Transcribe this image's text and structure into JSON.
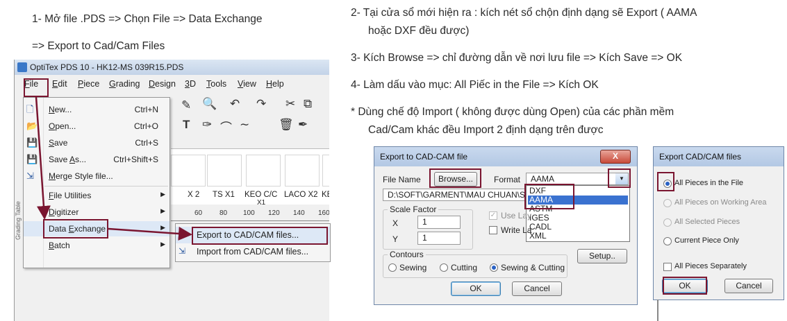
{
  "instructions": {
    "step1_line1": "1-  Mở file .PDS => Chọn File => Data Exchange",
    "step1_line2": "=> Export to Cad/Cam Files",
    "step2_line1": "2-  Tại cửa sổ mới hiện ra : kích nét sổ chộn định dạng sẽ Export ( AAMA",
    "step2_line2": "hoặc DXF đều được)",
    "step3": "3-  Kích Browse => chỉ đường dẫn về nơi lưu file => Kích Save => OK",
    "step4": "4- Làm dấu vào mục: All Piếc in the File => Kích OK",
    "note_line1": "* Dùng chế độ Import ( không được dùng Open) của các phần mềm",
    "note_line2": "Cad/Cam khác đều Import 2 định dạng trên được"
  },
  "pds_window": {
    "title": "OptiTex PDS 10 - HK12-MS 039R15.PDS",
    "side_tab": "Grading Table",
    "menu": [
      {
        "label": "File",
        "underline": "F",
        "rest": "ile"
      },
      {
        "label": "Edit",
        "underline": "E",
        "rest": "dit"
      },
      {
        "label": "Piece",
        "underline": "P",
        "rest": "iece"
      },
      {
        "label": "Grading",
        "underline": "G",
        "rest": "rading"
      },
      {
        "label": "Design",
        "underline": "D",
        "rest": "esign"
      },
      {
        "label": "3D",
        "underline": "3",
        "rest": "D"
      },
      {
        "label": "Tools",
        "underline": "T",
        "rest": "ools"
      },
      {
        "label": "View",
        "underline": "V",
        "rest": "iew"
      },
      {
        "label": "Help",
        "underline": "H",
        "rest": "elp"
      }
    ],
    "pieces": [
      "X 2",
      "TS X1",
      "KEO C/C",
      "LACO X2",
      "KEO L"
    ],
    "piece_sub": "X1",
    "ruler": [
      "60",
      "80",
      "100",
      "120",
      "140",
      "160"
    ],
    "file_menu": {
      "new": {
        "u": "N",
        "rest": "ew...",
        "shortcut": "Ctrl+N"
      },
      "open": {
        "u": "O",
        "rest": "pen...",
        "shortcut": "Ctrl+O"
      },
      "save": {
        "u": "S",
        "rest": "ave",
        "shortcut": "Ctrl+S"
      },
      "saveas": {
        "pre": "Save ",
        "u": "A",
        "rest": "s...",
        "shortcut": "Ctrl+Shift+S"
      },
      "merge": {
        "u": "M",
        "rest": "erge Style file..."
      },
      "file_utilities": {
        "u": "F",
        "rest": "ile Utilities"
      },
      "digitizer": {
        "u": "D",
        "rest": "igitizer"
      },
      "data_exchange": {
        "pre": "Data ",
        "u": "E",
        "rest": "xchange"
      },
      "batch": {
        "u": "B",
        "rest": "atch"
      }
    },
    "submenu": {
      "export": "Export to CAD/CAM files...",
      "import": "Import from CAD/CAM files..."
    }
  },
  "export_dialog": {
    "title": "Export to CAD-CAM file",
    "close": "X",
    "file_name_label": "File Name",
    "browse_button": "Browse...",
    "format_label": "Format",
    "format_value": "AAMA",
    "path_value": "D:\\SOFT\\GARMENT\\MAU CHUAN\\SO M",
    "format_options": [
      "DXF",
      "AAMA",
      "ASTM",
      "IGES",
      "CADL",
      "XML"
    ],
    "selected_format": "AAMA",
    "scale_factor_label": "Scale Factor",
    "x_label": "X",
    "x_value": "1",
    "y_label": "Y",
    "y_value": "1",
    "use_layers": "Use Lay",
    "write_layers": "Write La",
    "contours_label": "Contours",
    "contours": [
      "Sewing",
      "Cutting",
      "Sewing & Cutting"
    ],
    "contours_selected": "Sewing & Cutting",
    "setup_button": "Setup..",
    "ok_button": "OK",
    "cancel_button": "Cancel"
  },
  "files_dialog": {
    "title": "Export CAD/CAM files",
    "close": "X",
    "options": [
      {
        "label": "All Pieces in the File",
        "checked": true,
        "enabled": true
      },
      {
        "label": "All Pieces on Working Area",
        "checked": false,
        "enabled": false
      },
      {
        "label": "All Selected Pieces",
        "checked": false,
        "enabled": false
      },
      {
        "label": "Current Piece Only",
        "checked": false,
        "enabled": true
      }
    ],
    "separately": "All Pieces Separately",
    "ok_button": "OK",
    "cancel_button": "Cancel"
  },
  "colors": {
    "highlight": "#7a1530",
    "selection": "#3a72d0"
  }
}
